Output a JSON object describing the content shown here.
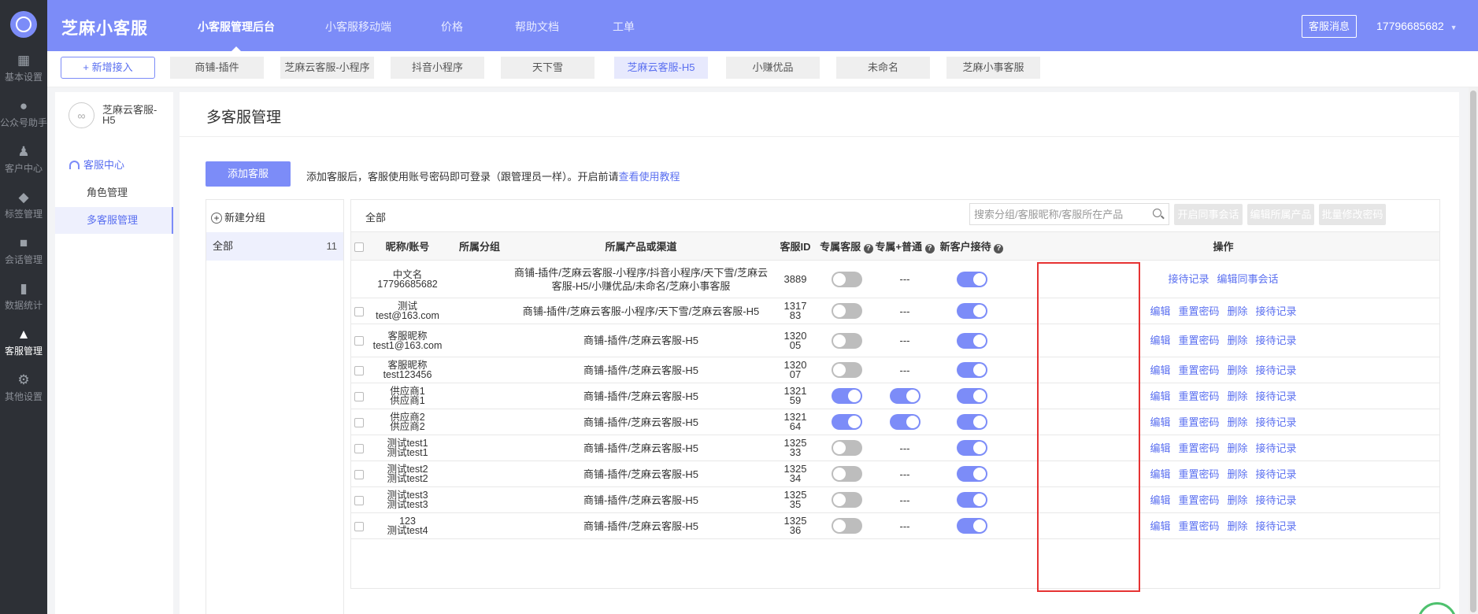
{
  "rail": {
    "items": [
      {
        "label": "基本设置",
        "icon": "grid-icon"
      },
      {
        "label": "公众号助手",
        "icon": "wechat-icon"
      },
      {
        "label": "客户中心",
        "icon": "users-icon"
      },
      {
        "label": "标签管理",
        "icon": "tag-icon"
      },
      {
        "label": "会话管理",
        "icon": "chat-icon"
      },
      {
        "label": "数据统计",
        "icon": "bar-chart-icon"
      },
      {
        "label": "客服管理",
        "icon": "robot-icon"
      },
      {
        "label": "其他设置",
        "icon": "gear-icon"
      }
    ]
  },
  "topbar": {
    "brand": "芝麻小客服",
    "nav": [
      "小客服管理后台",
      "小客服移动端",
      "价格",
      "帮助文档",
      "工单"
    ],
    "message_button": "客服消息",
    "user_phone": "17796685682"
  },
  "tabs": {
    "add_button": "新增接入",
    "products": [
      "商铺-插件",
      "芝麻云客服-小程序",
      "抖音小程序",
      "天下雪",
      "芝麻云客服-H5",
      "小赚优品",
      "未命名",
      "芝麻小事客服"
    ]
  },
  "subside": {
    "product_name": "芝麻云客服-H5",
    "section": "客服中心",
    "items": [
      "角色管理",
      "多客服管理"
    ]
  },
  "panel": {
    "title": "多客服管理",
    "add_button": "添加客服",
    "hint": "添加客服后，客服使用账号密码即可登录（跟管理员一样）。开启前请",
    "hint_link": "查看使用教程",
    "groups": {
      "new_group": "新建分组",
      "all_label": "全部",
      "all_count": "11"
    },
    "table_title": "全部",
    "search_placeholder": "搜索分组/客服昵称/客服所在产品",
    "batch_buttons": [
      "开启同事会话",
      "编辑所属产品",
      "批量修改密码"
    ],
    "columns": [
      "昵称/账号",
      "所属分组",
      "所属产品或渠道",
      "客服ID",
      "专属客服",
      "专属+普通",
      "新客户接待",
      "操作"
    ],
    "rows": [
      {
        "nick": "中文名",
        "account": "17796685682",
        "group": "",
        "channel": "商铺-插件/芝麻云客服-小程序/抖音小程序/天下雪/芝麻云客服-H5/小赚优品/未命名/芝麻小事客服",
        "id": "3889",
        "exclusive": false,
        "mixed": "---",
        "new_customer": true,
        "ops": [
          "接待记录",
          "编辑同事会话"
        ]
      },
      {
        "nick": "测试",
        "account": "test@163.com",
        "group": "",
        "channel": "商铺-插件/芝麻云客服-小程序/天下雪/芝麻云客服-H5",
        "id": "131783",
        "exclusive": false,
        "mixed": "---",
        "new_customer": true,
        "ops": [
          "编辑",
          "重置密码",
          "删除",
          "接待记录"
        ]
      },
      {
        "nick": "客服昵称",
        "account": "test1@163.com",
        "group": "",
        "channel": "商铺-插件/芝麻云客服-H5",
        "id": "132005",
        "exclusive": false,
        "mixed": "---",
        "new_customer": true,
        "ops": [
          "编辑",
          "重置密码",
          "删除",
          "接待记录"
        ]
      },
      {
        "nick": "客服昵称",
        "account": "test123456",
        "group": "",
        "channel": "商铺-插件/芝麻云客服-H5",
        "id": "132007",
        "exclusive": false,
        "mixed": "---",
        "new_customer": true,
        "ops": [
          "编辑",
          "重置密码",
          "删除",
          "接待记录"
        ]
      },
      {
        "nick": "供应商1",
        "account": "供应商1",
        "group": "",
        "channel": "商铺-插件/芝麻云客服-H5",
        "id": "132159",
        "exclusive": true,
        "mixed": true,
        "new_customer": true,
        "ops": [
          "编辑",
          "重置密码",
          "删除",
          "接待记录"
        ]
      },
      {
        "nick": "供应商2",
        "account": "供应商2",
        "group": "",
        "channel": "商铺-插件/芝麻云客服-H5",
        "id": "132164",
        "exclusive": true,
        "mixed": true,
        "new_customer": true,
        "ops": [
          "编辑",
          "重置密码",
          "删除",
          "接待记录"
        ]
      },
      {
        "nick": "测试test1",
        "account": "测试test1",
        "group": "",
        "channel": "商铺-插件/芝麻云客服-H5",
        "id": "132533",
        "exclusive": false,
        "mixed": "---",
        "new_customer": true,
        "ops": [
          "编辑",
          "重置密码",
          "删除",
          "接待记录"
        ]
      },
      {
        "nick": "测试test2",
        "account": "测试test2",
        "group": "",
        "channel": "商铺-插件/芝麻云客服-H5",
        "id": "132534",
        "exclusive": false,
        "mixed": "---",
        "new_customer": true,
        "ops": [
          "编辑",
          "重置密码",
          "删除",
          "接待记录"
        ]
      },
      {
        "nick": "测试test3",
        "account": "测试test3",
        "group": "",
        "channel": "商铺-插件/芝麻云客服-H5",
        "id": "132535",
        "exclusive": false,
        "mixed": "---",
        "new_customer": true,
        "ops": [
          "编辑",
          "重置密码",
          "删除",
          "接待记录"
        ]
      },
      {
        "nick": "123",
        "account": "测试test4",
        "group": "",
        "channel": "商铺-插件/芝麻云客服-H5",
        "id": "132536",
        "exclusive": false,
        "mixed": "---",
        "new_customer": true,
        "ops": [
          "编辑",
          "重置密码",
          "删除",
          "接待记录"
        ]
      }
    ]
  },
  "colors": {
    "accent": "#7c8cf8",
    "rail": "#2d3036",
    "highlight_box": "#e63333"
  }
}
